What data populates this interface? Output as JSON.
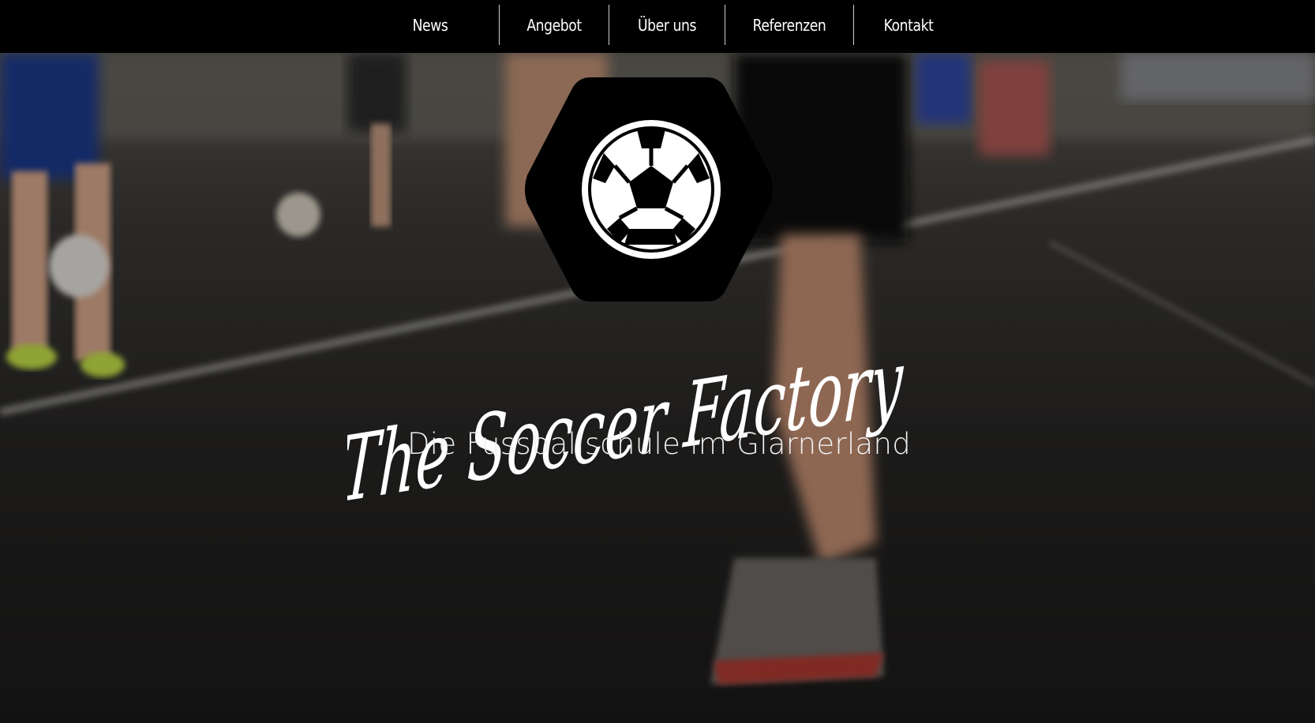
{
  "nav": {
    "items": [
      {
        "label": "News"
      },
      {
        "label": "Angebot"
      },
      {
        "label": "Über uns"
      },
      {
        "label": "Referenzen"
      },
      {
        "label": "Kontakt"
      }
    ]
  },
  "hero": {
    "title": "The Soccer Factory",
    "subtitle": "Die Fussballschule im Glarnerland",
    "logo_icon": "soccer-ball-icon"
  },
  "colors": {
    "nav_bg": "#000000",
    "nav_text": "#ffffff",
    "separator": "#cfcfcf",
    "logo_bg": "#000000",
    "text_light": "#ffffff"
  }
}
